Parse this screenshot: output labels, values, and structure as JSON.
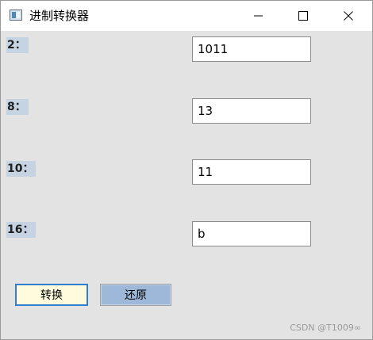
{
  "window": {
    "title": "进制转换器"
  },
  "rows": [
    {
      "label": "2：",
      "value": "1011"
    },
    {
      "label": "8：",
      "value": "13"
    },
    {
      "label": "10：",
      "value": "11"
    },
    {
      "label": "16：",
      "value": "b"
    }
  ],
  "buttons": {
    "convert": "转换",
    "restore": "还原"
  },
  "watermark": "CSDN @T1009∞",
  "icons": {
    "app": "app-window-icon",
    "minimize": "minimize-icon",
    "maximize": "maximize-icon",
    "close": "close-icon"
  },
  "colors": {
    "label_highlight": "#c5d3e2",
    "convert_bg": "#fffbdc",
    "convert_border": "#2f7fd0",
    "restore_bg": "#9db8d8",
    "window_bg": "#e3e3e3"
  }
}
